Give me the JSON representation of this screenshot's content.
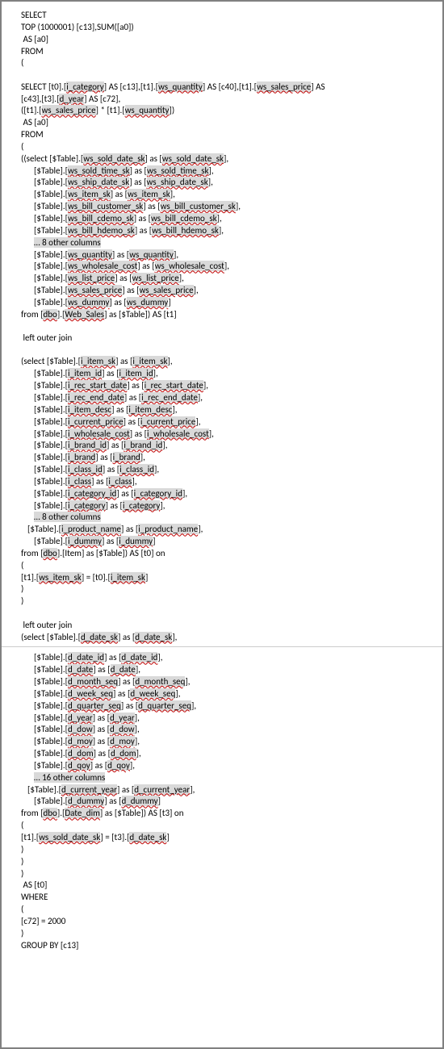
{
  "sql": {
    "l1": "SELECT",
    "l2": "TOP (1000001) [c13],SUM([a0])",
    "l3": " AS [a0]",
    "l4": "FROM",
    "l5": "(",
    "l6": "",
    "l7a": "SELECT [t0].[",
    "l7b": "i_category",
    "l7c": "] AS [c13],[t1].[",
    "l7d": "ws_quantity",
    "l7e": "] AS [c40],[t1].[",
    "l7f": "ws_sales_price",
    "l7g": "] AS ",
    "l7h": "[c43],[t3].[",
    "l7i": "d_year",
    "l7j": "] AS [c72],",
    "l8a": "([t1].[",
    "l8b": "ws_sales_price",
    "l8c": "] * [t1].[",
    "l8d": "ws_quantity",
    "l8e": "])",
    "l9": " AS [a0]",
    "l10": "FROM",
    "l11": "(",
    "ws1a": "((select [$Table].[",
    "ws1b": "ws_sold_date_sk",
    "ws1c": "] as [",
    "ws1d": "ws_sold_date_sk",
    "ws1e": "],",
    "ws2a": "[$Table].[",
    "ws2b": "ws_sold_time_sk",
    "ws2c": "] as [",
    "ws2d": "ws_sold_time_sk",
    "ws2e": "],",
    "ws3a": "[$Table].[",
    "ws3b": "ws_ship_date_sk",
    "ws3c": "] as [",
    "ws3d": "ws_ship_date_sk",
    "ws3e": "],",
    "ws4a": "[$Table].[",
    "ws4b": "ws_item_sk",
    "ws4c": "] as [",
    "ws4d": "ws_item_sk",
    "ws4e": "],",
    "ws5a": "[$Table].[",
    "ws5b": "ws_bill_customer_sk",
    "ws5c": "] as [",
    "ws5d": "ws_bill_customer_sk",
    "ws5e": "],",
    "ws6a": "[$Table].[",
    "ws6b": "ws_bill_cdemo_sk",
    "ws6c": "] as [",
    "ws6d": "ws_bill_cdemo_sk",
    "ws6e": "],",
    "ws7a": "[$Table].[",
    "ws7b": "ws_bill_hdemo_sk",
    "ws7c": "] as [",
    "ws7d": "ws_bill_hdemo_sk",
    "ws7e": "],",
    "wsOmit": "… 8 other columns",
    "ws8a": "[$Table].[",
    "ws8b": "ws_quantity",
    "ws8c": "] as [",
    "ws8d": "ws_quantity",
    "ws8e": "],",
    "ws9a": "[$Table].[",
    "ws9b": "ws_wholesale_cost",
    "ws9c": "] as [",
    "ws9d": "ws_wholesale_cost",
    "ws9e": "],",
    "ws10a": "[$Table].[",
    "ws10b": "ws_list_price",
    "ws10c": "] as [",
    "ws10d": "ws_list_price",
    "ws10e": "],",
    "ws11a": "[$Table].[",
    "ws11b": "ws_sales_price",
    "ws11c": "] as [",
    "ws11d": "ws_sales_price",
    "ws11e": "],",
    "ws12a": "[$Table].[",
    "ws12b": "ws_dummy",
    "ws12c": "] as [",
    "ws12d": "ws_dummy",
    "ws12e": "]",
    "wsFromA": "from [",
    "wsFromB": "dbo",
    "wsFromC": "].[",
    "wsFromD": "Web_Sales",
    "wsFromE": "] as [$Table]) AS [t1]",
    "joinOuter": " left outer join",
    "it1a": "(select [$Table].[",
    "it1b": "i_item_sk",
    "it1c": "] as [",
    "it1d": "i_item_sk",
    "it1e": "],",
    "it2a": "[$Table].[",
    "it2b": "i_item_id",
    "it2c": "] as [",
    "it2d": "i_item_id",
    "it2e": "],",
    "it3a": "[$Table].[",
    "it3b": "i_rec_start_date",
    "it3c": "] as [",
    "it3d": "i_rec_start_date",
    "it3e": "],",
    "it4a": "[$Table].[",
    "it4b": "i_rec_end_date",
    "it4c": "] as [",
    "it4d": "i_rec_end_date",
    "it4e": "],",
    "it5a": "[$Table].[",
    "it5b": "i_item_desc",
    "it5c": "] as [",
    "it5d": "i_item_desc",
    "it5e": "],",
    "it6a": "[$Table].[",
    "it6b": "i_current_price",
    "it6c": "] as [",
    "it6d": "i_current_price",
    "it6e": "],",
    "it7a": "[$Table].[",
    "it7b": "i_wholesale_cost",
    "it7c": "] as [",
    "it7d": "i_wholesale_cost",
    "it7e": "],",
    "it8a": "[$Table].[",
    "it8b": "i_brand_id",
    "it8c": "] as [",
    "it8d": "i_brand_id",
    "it8e": "],",
    "it9a": "[$Table].[",
    "it9b": "i_brand",
    "it9c": "] as [",
    "it9d": "i_brand",
    "it9e": "],",
    "it10a": "[$Table].[",
    "it10b": "i_class_id",
    "it10c": "] as [",
    "it10d": "i_class_id",
    "it10e": "],",
    "it11a": "[$Table].[",
    "it11b": "i_class",
    "it11c": "] as [",
    "it11d": "i_class",
    "it11e": "],",
    "it12a": "[$Table].[",
    "it12b": "i_category_id",
    "it12c": "] as [",
    "it12d": "i_category_id",
    "it12e": "],",
    "it13a": "[$Table].[",
    "it13b": "i_category",
    "it13c": "] as [",
    "it13d": "i_category",
    "it13e": "],",
    "itOmit": "… 8 other columns",
    "it14a": "[$Table].[",
    "it14b": "i_product_name",
    "it14c": "] as [",
    "it14d": "i_product_name",
    "it14e": "],",
    "it15a": "[$Table].[",
    "it15b": "i_dummy",
    "it15c": "] as [",
    "it15d": "i_dummy",
    "it15e": "]",
    "itFromA": "from [",
    "itFromB": "dbo",
    "itFromC": "].[Item] as [$Table]) AS [t0] on",
    "itOn1": "(",
    "itOn2a": "[t1].[",
    "itOn2b": "ws_item_sk",
    "itOn2c": "] = [t0].[",
    "itOn2d": "i_item_sk",
    "itOn2e": "]",
    "itOn3": ")",
    "itOn4": ")",
    "dt1a": "(select [$Table].[",
    "dt1b": "d_date_sk",
    "dt1c": "] as [",
    "dt1d": "d_date_sk",
    "dt1e": "],",
    "dt2a": "[$Table].[",
    "dt2b": "d_date_id",
    "dt2c": "] as [",
    "dt2d": "d_date_id",
    "dt2e": "],",
    "dt3a": "[$Table].[",
    "dt3b": "d_date",
    "dt3c": "] as [",
    "dt3d": "d_date",
    "dt3e": "],",
    "dt4a": "[$Table].[",
    "dt4b": "d_month_seq",
    "dt4c": "] as [",
    "dt4d": "d_month_seq",
    "dt4e": "],",
    "dt5a": "[$Table].[",
    "dt5b": "d_week_seq",
    "dt5c": "] as [",
    "dt5d": "d_week_seq",
    "dt5e": "],",
    "dt6a": "[$Table].[",
    "dt6b": "d_quarter_seq",
    "dt6c": "] as [",
    "dt6d": "d_quarter_seq",
    "dt6e": "],",
    "dt7a": "[$Table].[",
    "dt7b": "d_year",
    "dt7c": "] as [",
    "dt7d": "d_year",
    "dt7e": "],",
    "dt8a": "[$Table].[",
    "dt8b": "d_dow",
    "dt8c": "] as [",
    "dt8d": "d_dow",
    "dt8e": "],",
    "dt9a": "[$Table].[",
    "dt9b": "d_moy",
    "dt9c": "] as [",
    "dt9d": "d_moy",
    "dt9e": "],",
    "dt10a": "[$Table].[",
    "dt10b": "d_dom",
    "dt10c": "] as [",
    "dt10d": "d_dom",
    "dt10e": "],",
    "dt11a": "[$Table].[",
    "dt11b": "d_qoy",
    "dt11c": "] as [",
    "dt11d": "d_qoy",
    "dt11e": "],",
    "dtOmit": "… 16 other columns",
    "dt12a": "[$Table].[",
    "dt12b": "d_current_year",
    "dt12c": "] as [",
    "dt12d": "d_current_year",
    "dt12e": "],",
    "dt13a": "[$Table].[",
    "dt13b": "d_dummy",
    "dt13c": "] as [",
    "dt13d": "d_dummy",
    "dt13e": "]",
    "dtFromA": "from [",
    "dtFromB": "dbo",
    "dtFromC": "].[",
    "dtFromD": "Date_dim",
    "dtFromE": "] as [$Table]) AS [t3] on",
    "dtOn1": "(",
    "dtOn2a": "[t1].[",
    "dtOn2b": "ws_sold_date_sk",
    "dtOn2c": "] = [t3].[",
    "dtOn2d": "d_date_sk",
    "dtOn2e": "]",
    "dtOn3": ")",
    "dtOn4": ")",
    "close1": ")",
    "close2": " AS [t0]",
    "whereK": "WHERE",
    "where1": "(",
    "where2": "[c72] = 2000",
    "where3": ")",
    "group": "GROUP BY [c13]"
  }
}
